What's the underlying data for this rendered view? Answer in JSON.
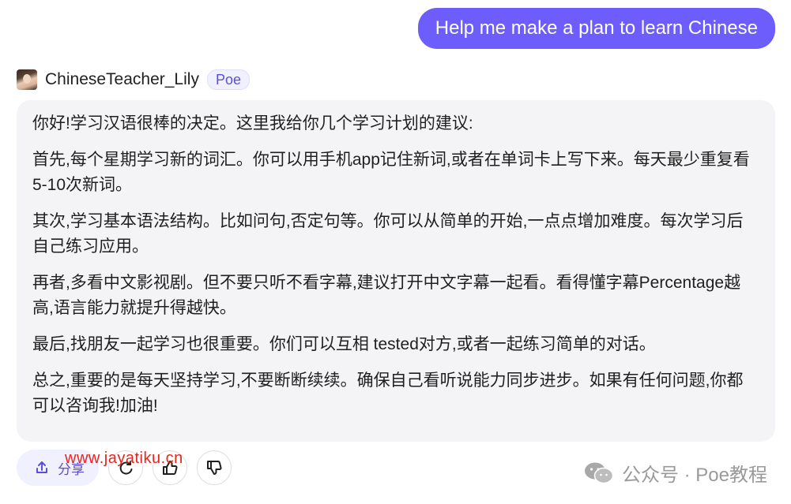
{
  "user_message": "Help me make a plan to learn Chinese",
  "bot": {
    "name": "ChineseTeacher_Lily",
    "platform_badge": "Poe",
    "paragraphs": [
      "你好!学习汉语很棒的决定。这里我给你几个学习计划的建议:",
      "首先,每个星期学习新的词汇。你可以用手机app记住新词,或者在单词卡上写下来。每天最少重复看5-10次新词。",
      "其次,学习基本语法结构。比如问句,否定句等。你可以从简单的开始,一点点增加难度。每次学习后自己练习应用。",
      "再者,多看中文影视剧。但不要只听不看字幕,建议打开中文字幕一起看。看得懂字幕Percentage越高,语言能力就提升得越快。",
      "最后,找朋友一起学习也很重要。你们可以互相 tested对方,或者一起练习简单的对话。",
      "总之,重要的是每天坚持学习,不要断断续续。确保自己看听说能力同步进步。如果有任何问题,你都可以咨询我!加油!"
    ]
  },
  "actions": {
    "share_label": "分享",
    "share_icon": "share-icon",
    "retry_icon": "retry-icon",
    "like_icon": "thumbs-up-icon",
    "dislike_icon": "thumbs-down-icon"
  },
  "watermarks": {
    "url": "www.jayatiku.cn",
    "wechat": "公众号 · Poe教程"
  },
  "colors": {
    "user_bubble": "#6d5dfc",
    "bot_bubble": "#f4f4f6",
    "accent": "#5b4fd6",
    "watermark_url": "#e5261f"
  }
}
